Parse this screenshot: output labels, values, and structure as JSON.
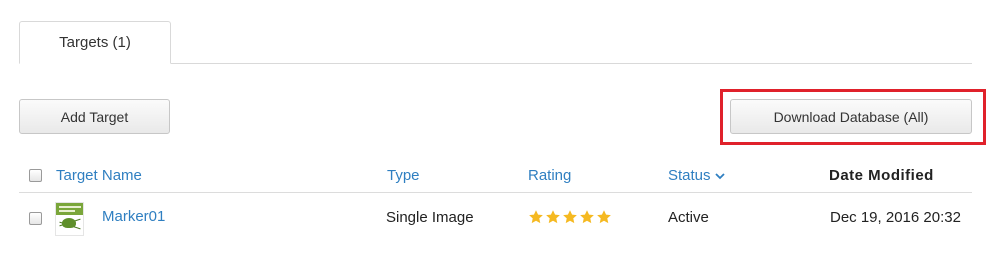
{
  "tabs": [
    {
      "label": "Targets (1)"
    }
  ],
  "toolbar": {
    "add_target_label": "Add Target",
    "download_database_label": "Download Database (All)"
  },
  "table": {
    "columns": {
      "target_name": "Target Name",
      "type": "Type",
      "rating": "Rating",
      "status": "Status",
      "date_modified": "Date Modified"
    },
    "rows": [
      {
        "name": "Marker01",
        "type": "Single Image",
        "rating": 5,
        "status": "Active",
        "date_modified": "Dec 19, 2016 20:32"
      }
    ]
  },
  "colors": {
    "link": "#2f7fc1",
    "star": "#f5b921",
    "highlight": "#e0212b"
  },
  "icons": {
    "sort": "chevron-down-icon",
    "rating": "star-icon"
  }
}
